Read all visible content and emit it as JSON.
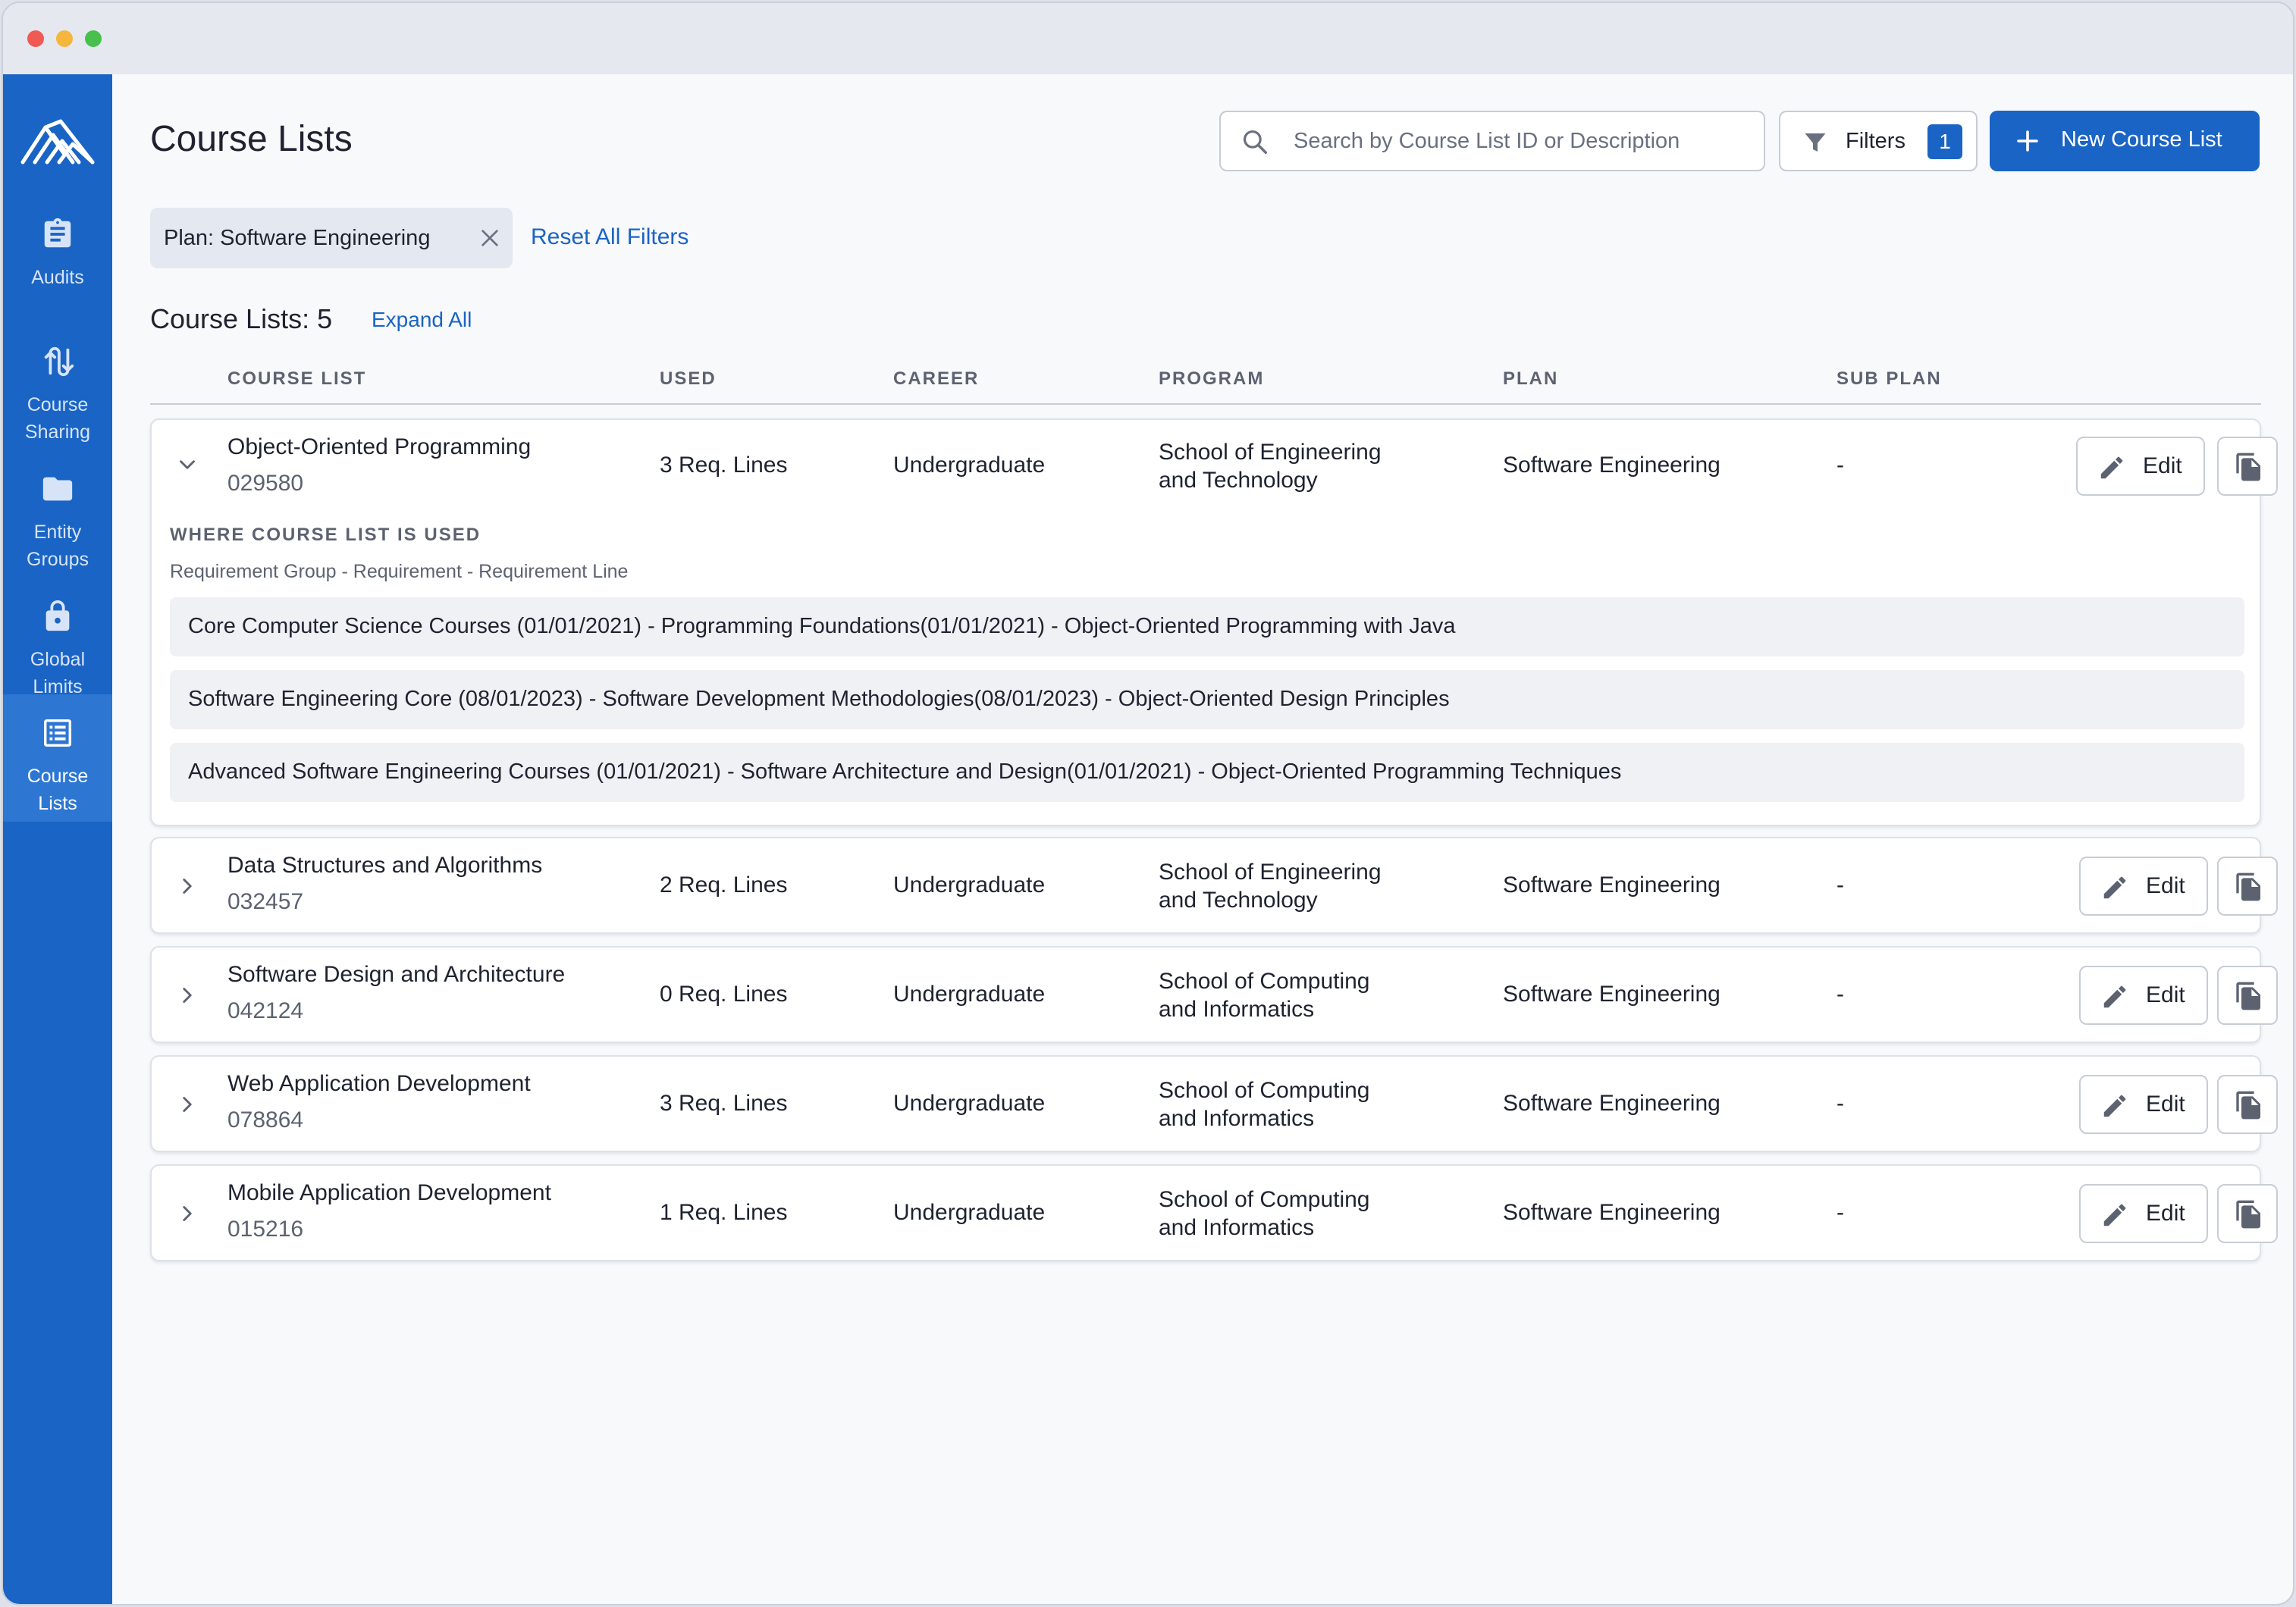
{
  "window": {
    "controls": [
      "close",
      "minimize",
      "maximize"
    ]
  },
  "sidebar": {
    "logo": "mountain-logo",
    "items": [
      {
        "label": "Audits",
        "icon": "clipboard-icon",
        "active": false
      },
      {
        "label": "Course\nSharing",
        "icon": "course-sharing-icon",
        "active": false
      },
      {
        "label": "Entity\nGroups",
        "icon": "folder-icon",
        "active": false
      },
      {
        "label": "Global\nLimits",
        "icon": "lock-icon",
        "active": false
      },
      {
        "label": "Course\nLists",
        "icon": "list-icon",
        "active": true
      }
    ]
  },
  "header": {
    "title": "Course Lists",
    "search": {
      "placeholder": "Search by Course List ID or Description",
      "value": ""
    },
    "filters_label": "Filters",
    "filters_count": "1",
    "new_button_label": "New Course List"
  },
  "filter_bar": {
    "chip_label": "Plan: Software Engineering",
    "reset_label": "Reset All Filters"
  },
  "summary": {
    "label": "Course Lists:",
    "count": "5",
    "expand_label": "Expand All"
  },
  "table": {
    "columns": [
      "COURSE LIST",
      "USED",
      "CAREER",
      "PROGRAM",
      "PLAN",
      "SUB PLAN"
    ],
    "edit_label": "Edit",
    "rows": [
      {
        "name": "Object-Oriented Programming",
        "id": "029580",
        "used": "3 Req. Lines",
        "career": "Undergraduate",
        "program_line1": "School of Engineering",
        "program_line2": "and Technology",
        "plan": "Software Engineering",
        "sub_plan": "-",
        "expanded": true
      },
      {
        "name": "Data Structures and Algorithms",
        "id": "032457",
        "used": "2 Req. Lines",
        "career": "Undergraduate",
        "program_line1": "School of Engineering",
        "program_line2": "and Technology",
        "plan": "Software Engineering",
        "sub_plan": "-",
        "expanded": false
      },
      {
        "name": "Software Design and Architecture",
        "id": "042124",
        "used": "0 Req. Lines",
        "career": "Undergraduate",
        "program_line1": "School of Computing",
        "program_line2": "and Informatics",
        "plan": "Software Engineering",
        "sub_plan": "-",
        "expanded": false
      },
      {
        "name": "Web Application Development",
        "id": "078864",
        "used": "3 Req. Lines",
        "career": "Undergraduate",
        "program_line1": "School of Computing",
        "program_line2": "and Informatics",
        "plan": "Software Engineering",
        "sub_plan": "-",
        "expanded": false
      },
      {
        "name": "Mobile Application Development",
        "id": "015216",
        "used": "1 Req. Lines",
        "career": "Undergraduate",
        "program_line1": "School of Computing",
        "program_line2": "and Informatics",
        "plan": "Software Engineering",
        "sub_plan": "-",
        "expanded": false
      }
    ]
  },
  "usage_panel": {
    "title": "WHERE COURSE LIST IS USED",
    "subtitle": "Requirement Group - Requirement - Requirement Line",
    "entries": [
      "Core Computer Science Courses (01/01/2021) - Programming Foundations(01/01/2021) - Object-Oriented Programming with Java",
      "Software Engineering Core (08/01/2023) - Software Development Methodologies(08/01/2023) - Object-Oriented Design Principles",
      "Advanced Software Engineering Courses (01/01/2021) - Software Architecture and Design(01/01/2021) - Object-Oriented Programming Techniques"
    ]
  },
  "colors": {
    "brand": "#1a64c5",
    "sidebar_active": "#2d77d3",
    "text": "#1f2330",
    "muted": "#5c6270",
    "border": "#c7ccd6"
  }
}
